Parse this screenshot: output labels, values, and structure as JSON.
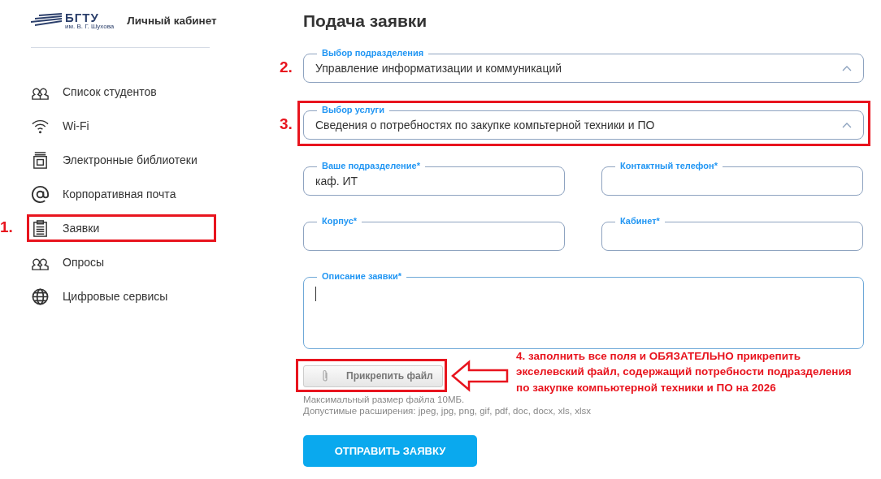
{
  "sidebar": {
    "logo": {
      "name": "БГТУ",
      "subtitle": "им. В. Г. Шухова"
    },
    "title": "Личный кабинет",
    "items": [
      {
        "label": "Список студентов",
        "kind": "people",
        "selected": false
      },
      {
        "label": "Wi-Fi",
        "kind": "wifi",
        "selected": false
      },
      {
        "label": "Электронные библиотеки",
        "kind": "library",
        "selected": false
      },
      {
        "label": "Корпоративная почта",
        "kind": "mail",
        "selected": false
      },
      {
        "label": "Заявки",
        "kind": "requests",
        "selected": true,
        "annotation": "1."
      },
      {
        "label": "Опросы",
        "kind": "people",
        "selected": false
      },
      {
        "label": "Цифровые сервисы",
        "kind": "services",
        "selected": false
      }
    ]
  },
  "form": {
    "title": "Подача заявки",
    "selects": [
      {
        "label": "Выбор подразделения",
        "value": "Управление информатизации и коммуникаций",
        "annotation": "2."
      },
      {
        "label": "Выбор услуги",
        "value": "Сведения о потребностях по закупке компьтерной техники и ПО",
        "annotation": "3.",
        "highlighted": true
      }
    ],
    "fields": [
      {
        "label": "Ваше подразделение*",
        "value": "каф. ИТ"
      },
      {
        "label": "Контактный телефон*"
      },
      {
        "label": "Корпус*"
      },
      {
        "label": "Кабинет*"
      }
    ],
    "description": {
      "label": "Описание заявки*",
      "focused": true
    },
    "attach": {
      "label": "Прикрепить файл",
      "highlighted": true
    },
    "hints": [
      "Максимальный размер файла 10МБ.",
      "Допустимые расширения: jpeg, jpg, png, gif, pdf, doc, docx, xls, xlsx"
    ],
    "note": "4. заполнить все поля и ОБЯЗАТЕЛЬНО прикрепить экселевский файл, содержащий потребности подразделения по закупке компьютерной техники и ПО на 2026",
    "submit": "ОТПРАВИТЬ ЗАЯВКУ"
  }
}
